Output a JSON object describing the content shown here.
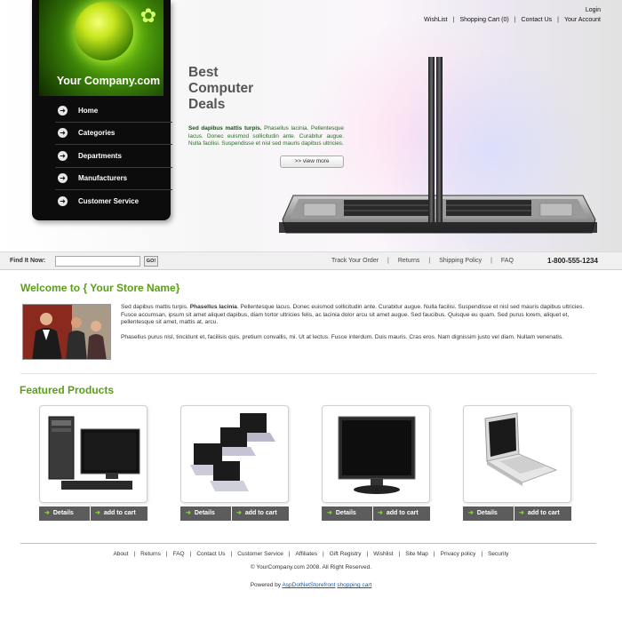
{
  "header": {
    "login": "Login",
    "top_links": [
      "WishList",
      "Shopping Cart (0)",
      "Contact Us",
      "Your Account"
    ],
    "company_name": "Your Company.com"
  },
  "nav": {
    "items": [
      "Home",
      "Categories",
      "Departments",
      "Manufacturers",
      "Customer Service"
    ]
  },
  "hero": {
    "title_lines": [
      "Best",
      "Computer",
      "Deals"
    ],
    "text_bold": "Sed dapibus mattis turpis.",
    "text": " Phasellus lacinia. Pellentesque lacus. Donec euismod sollicitudin ante. Curabitur augue. Nulla facilisi. Suspendisse et nisl sed mauris dapibus ultricies.",
    "view_more": ">>  view more"
  },
  "searchbar": {
    "label": "Find It Now:",
    "input_value": "",
    "go": "GO!",
    "links": [
      "Track Your Order",
      "Returns",
      "Shipping Policy",
      "FAQ"
    ],
    "phone": "1-800-555-1234"
  },
  "welcome": {
    "title": "Welcome to { Your Store Name}",
    "p1_start": "Sed dapibus mattis turpis. ",
    "p1_bold": "Phasellus lacinia",
    "p1_rest": ". Pellentesque lacus. Donec euismod sollicitudin ante. Curabitur augue. Nulla facilisi. Suspendisse et nisl sed mauris dapibus ultricies. Fusce accumsan, ipsum sit amet aliquet dapibus, diam tortor ultricies felis, ac lacinia dolor arcu sit amet augue. Sed faucibus. Quisque eu quam. Sed purus lorem, aliquet et, pellentesque sit amet, mattis at, arcu.",
    "p2": "Phasellus purus nisl, tincidunt et, facilisis quis, pretium convallis, mi. Ut at lectus. Fusce interdum. Duis mauris. Cras eros. Nam dignissim justo vel diam. Nullam venenatis."
  },
  "featured": {
    "title": "Featured Products",
    "products": [
      {
        "image": "desktop-tower-icon",
        "details": "Details",
        "add_to_cart": "add to cart"
      },
      {
        "image": "laptops-group-icon",
        "details": "Details",
        "add_to_cart": "add to cart"
      },
      {
        "image": "lcd-monitor-icon",
        "details": "Details",
        "add_to_cart": "add to cart"
      },
      {
        "image": "white-laptop-icon",
        "details": "Details",
        "add_to_cart": "add to cart"
      }
    ]
  },
  "footer": {
    "links": [
      "About",
      "Returns",
      "FAQ",
      "Contact Us",
      "Customer Service",
      "Affiliates",
      "Gift Registry",
      "Wishlist",
      "Site Map",
      "Privacy policy",
      "Security"
    ],
    "copyright": "© YourCompany.com 2008. All Right Reserved.",
    "powered_prefix": "Powered by ",
    "powered_link": "AspDotNetStorefront",
    "powered_suffix": "shopping cart"
  },
  "colors": {
    "accent_green": "#5a9e16",
    "nav_bg": "#0c0c0c",
    "button_bg": "#5c5c5c"
  }
}
